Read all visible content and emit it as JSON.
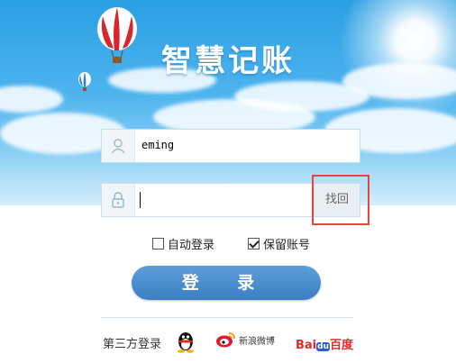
{
  "app": {
    "title": "智慧记账"
  },
  "username": {
    "value": "eming"
  },
  "password": {
    "value": "",
    "recover_label": "找回"
  },
  "options": {
    "auto_login_label": "自动登录",
    "auto_login_checked": false,
    "remember_label": "保留账号",
    "remember_checked": true
  },
  "login": {
    "label": "登 录"
  },
  "third_party": {
    "label": "第三方登录",
    "providers": [
      {
        "name": "QQ",
        "icon": "qq-penguin-icon"
      },
      {
        "name": "新浪微博",
        "icon": "weibo-icon"
      },
      {
        "name": "Baidu百度",
        "icon": "baidu-icon"
      }
    ]
  },
  "colors": {
    "accent": "#3c7fc2",
    "highlight": "#e0473f"
  }
}
